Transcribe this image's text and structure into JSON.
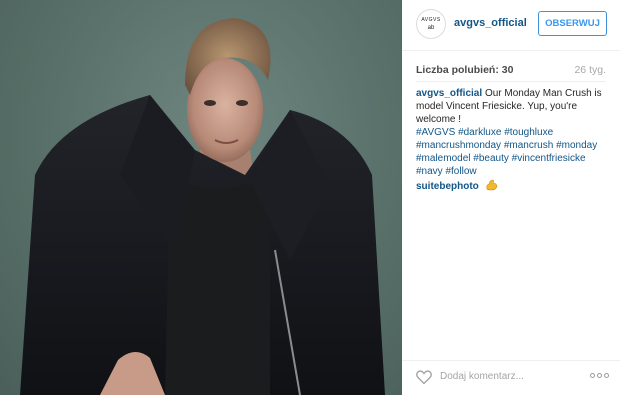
{
  "post": {
    "image_alt": "Young man with curly blond hair in a dark wool coat against a green-grey background"
  },
  "header": {
    "avatar_text": "AVGVS",
    "avatar_mark": "ab",
    "username": "avgvs_official",
    "follow_label": "OBSERWUJ"
  },
  "stats": {
    "likes": "Liczba polubień: 30",
    "time_ago": "26 tyg."
  },
  "caption": {
    "username": "avgvs_official",
    "text": "Our Monday Man Crush is model Vincent Friesicke. Yup, you're welcome !",
    "hashtags": [
      "#AVGVS",
      "#darkluxe",
      "#toughluxe",
      "#mancrushmonday",
      "#mancrush",
      "#monday",
      "#malemodel",
      "#beauty",
      "#vincentfriesicke",
      "#navy",
      "#follow"
    ]
  },
  "comments": [
    {
      "username": "suitebephoto",
      "emoji": "flexed-biceps-icon"
    }
  ],
  "footer": {
    "comment_placeholder": "Dodaj komentarz...",
    "like_icon": "heart-icon",
    "more_icon": "more-options-icon"
  },
  "colors": {
    "link": "#125688",
    "follow_button": "#3897f0",
    "photo_background": "#5c746d"
  }
}
